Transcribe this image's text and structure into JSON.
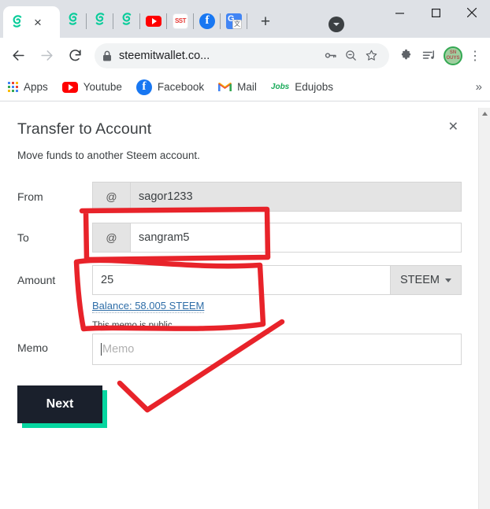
{
  "browser": {
    "tabs": {
      "active_icon": "steemit-icon",
      "close_label": "×",
      "pinned": [
        {
          "name": "steemit-tab-2",
          "icon": "steemit-icon"
        },
        {
          "name": "steemit-tab-3",
          "icon": "steemit-icon"
        },
        {
          "name": "steemit-tab-4",
          "icon": "steemit-icon"
        },
        {
          "name": "youtube-tab",
          "icon": "youtube-icon"
        },
        {
          "name": "sst-tab",
          "icon": "sst-icon",
          "label": "SST"
        },
        {
          "name": "facebook-tab",
          "icon": "facebook-icon",
          "label": "f"
        },
        {
          "name": "google-translate-tab",
          "icon": "google-translate-icon",
          "label": "G"
        }
      ],
      "new_tab_label": "+"
    },
    "window_controls": {
      "minimize": "—",
      "maximize": "☐",
      "close": "✕"
    },
    "toolbar": {
      "back": "←",
      "forward": "→",
      "reload": "⟳",
      "url": "steemitwallet.co...",
      "lock": "lock-icon",
      "key": "key-icon",
      "zoom_out": "zoom-out-icon",
      "bookmark_star": "star-icon",
      "extensions": "puzzle-icon",
      "media": "media-icon",
      "avatar_text": "SN OUYS",
      "menu": "⋮"
    },
    "bookmarks": {
      "items": [
        {
          "label": "Apps",
          "icon": "apps-grid-icon"
        },
        {
          "label": "Youtube",
          "icon": "youtube-icon"
        },
        {
          "label": "Facebook",
          "icon": "facebook-icon"
        },
        {
          "label": "Mail",
          "icon": "gmail-icon"
        },
        {
          "label": "Edujobs",
          "icon": "jobs-icon"
        }
      ],
      "overflow": "»"
    }
  },
  "dialog": {
    "title": "Transfer to Account",
    "subtitle": "Move funds to another Steem account.",
    "close_label": "✕",
    "fields": {
      "from": {
        "label": "From",
        "addon": "@",
        "value": "sagor1233"
      },
      "to": {
        "label": "To",
        "addon": "@",
        "value": "sangram5"
      },
      "amount": {
        "label": "Amount",
        "value": "25",
        "unit": "STEEM",
        "balance": "Balance: 58.005 STEEM"
      },
      "memo": {
        "label": "Memo",
        "hint": "This memo is public",
        "placeholder": "Memo",
        "value": ""
      }
    },
    "next_button": "Next"
  },
  "colors": {
    "annotation_red": "#e8232a",
    "accent_teal": "#06d6a0",
    "button_dark": "#1a202c",
    "link_blue": "#2f6ea8"
  }
}
